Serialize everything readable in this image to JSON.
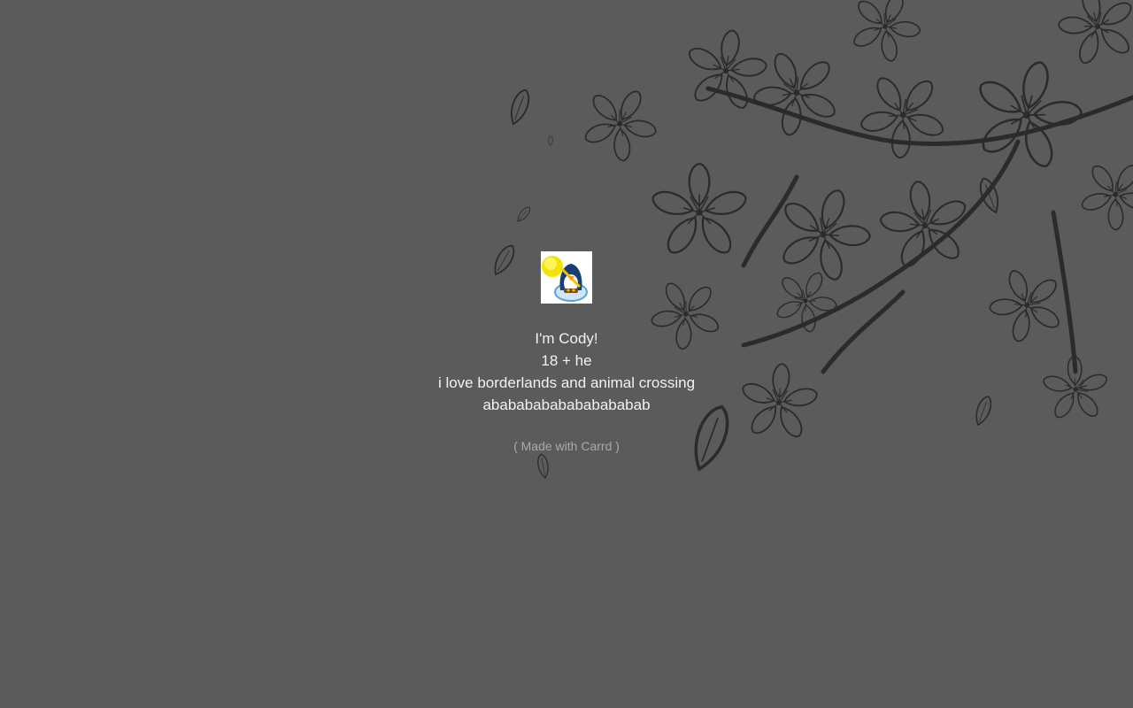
{
  "colors": {
    "background": "#5b5b5b",
    "text": "#f2f2f2",
    "credit_text": "#a9a9a9",
    "line_art": "#2b2b2b"
  },
  "profile": {
    "avatar_icon": "penguin-avatar-icon",
    "bio_lines": [
      "I'm Cody!",
      "18 + he",
      "i love borderlands and animal crossing",
      "abababababababababab"
    ]
  },
  "footer": {
    "credit_label": "( Made with Carrd )"
  }
}
